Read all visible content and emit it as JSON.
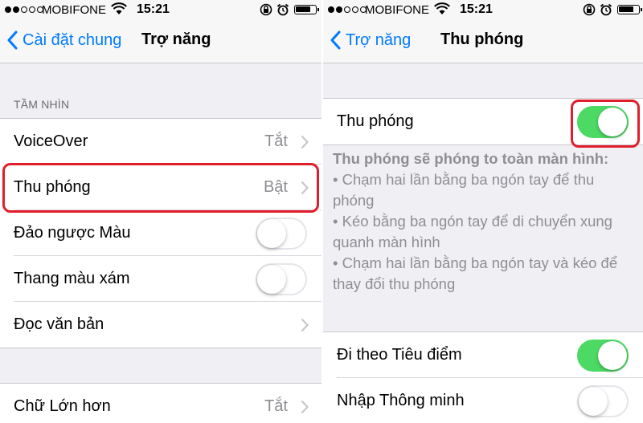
{
  "status_bar": {
    "carrier": "MOBIFONE",
    "time": "15:21"
  },
  "left": {
    "back_label": "Cài đặt chung",
    "title": "Trợ năng",
    "section_header": "TẦM NHÌN",
    "rows": [
      {
        "label": "VoiceOver",
        "value": "Tắt"
      },
      {
        "label": "Thu phóng",
        "value": "Bật"
      },
      {
        "label": "Đảo ngược Màu",
        "toggle_on": false
      },
      {
        "label": "Thang màu xám",
        "toggle_on": false
      },
      {
        "label": "Đọc văn bản"
      }
    ],
    "large_text": {
      "label": "Chữ Lớn hơn",
      "value": "Tắt"
    }
  },
  "right": {
    "back_label": "Trợ năng",
    "title": "Thu phóng",
    "zoom_row": {
      "label": "Thu phóng",
      "toggle_on": true
    },
    "description": {
      "title": "Thu phóng sẽ phóng to toàn màn hình:",
      "bullets": [
        "• Chạm hai lần bằng ba ngón tay để thu phóng",
        "• Kéo bằng ba ngón tay để di chuyển xung quanh màn hình",
        "• Chạm hai lần bằng ba ngón tay và kéo để thay đổi thu phóng"
      ]
    },
    "rows": [
      {
        "label": "Đi theo Tiêu điểm",
        "toggle_on": true
      },
      {
        "label": "Nhập Thông minh",
        "toggle_on": false
      }
    ]
  },
  "colors": {
    "accent": "#007aff",
    "toggle_on": "#4cd964",
    "highlight": "#e01e2b"
  }
}
